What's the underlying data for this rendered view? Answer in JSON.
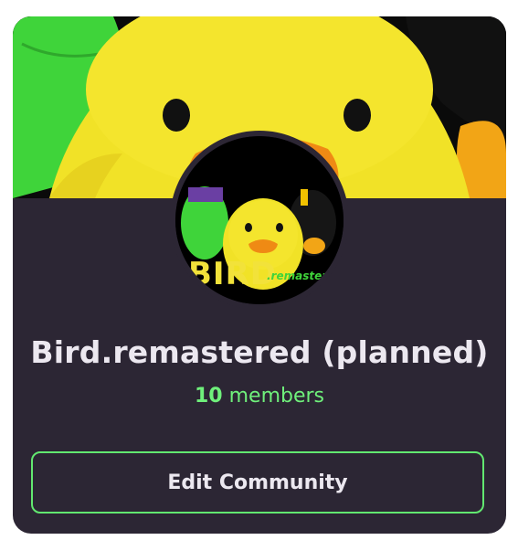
{
  "community": {
    "name": "Bird.remastered (planned)",
    "member_count": "10",
    "member_label": "members",
    "edit_button_label": "Edit Community",
    "avatar_logo_text": "BIRD",
    "avatar_logo_subtext": ".remastered"
  },
  "colors": {
    "card_background": "#2c2634",
    "accent_green": "#6ff07b",
    "button_border": "#62e870",
    "text_primary": "#ece8f0"
  }
}
